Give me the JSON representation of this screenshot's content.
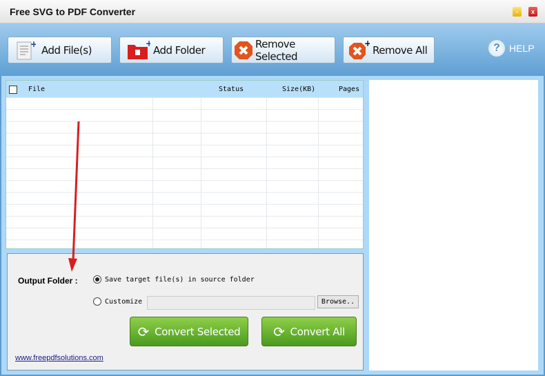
{
  "window": {
    "title": "Free SVG to PDF Converter",
    "minimize": "-",
    "close": "x"
  },
  "toolbar": {
    "add_files": "Add File(s)",
    "add_folder": "Add Folder",
    "remove_selected": "Remove Selected",
    "remove_all": "Remove All",
    "help": "HELP"
  },
  "list": {
    "columns": [
      "File",
      "Status",
      "Size(KB)",
      "Pages"
    ]
  },
  "output": {
    "label": "Output Folder :",
    "option_source": "Save target file(s) in source folder",
    "option_customize": "Customize",
    "path_value": "",
    "browse": "Browse..",
    "selected": "source"
  },
  "actions": {
    "convert_selected": "Convert Selected",
    "convert_all": "Convert All"
  },
  "footer": {
    "link": "www.freepdfsolutions.com"
  },
  "colors": {
    "toolbar": "#5e9fd3",
    "convert": "#4a9a1e",
    "annotation_arrow": "#d42020"
  }
}
